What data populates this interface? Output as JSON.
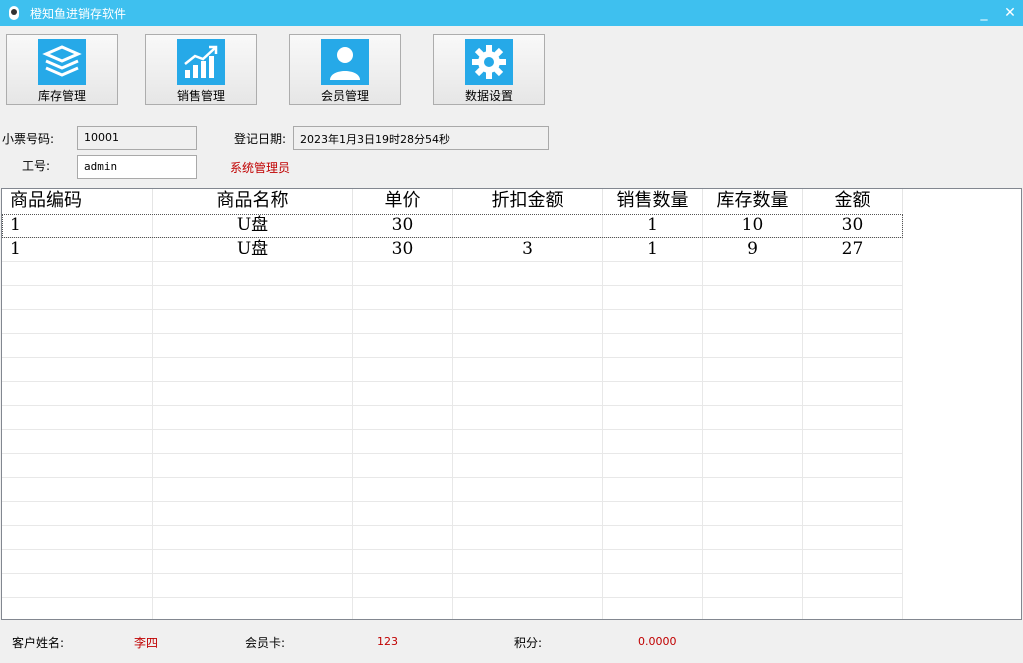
{
  "window": {
    "title": "橙知鱼进销存软件",
    "minimize": "_",
    "close": "✕"
  },
  "toolbar": [
    {
      "label": "库存管理",
      "icon": "layers-icon"
    },
    {
      "label": "销售管理",
      "icon": "bar-chart-icon"
    },
    {
      "label": "会员管理",
      "icon": "user-icon"
    },
    {
      "label": "数据设置",
      "icon": "gear-icon"
    }
  ],
  "form": {
    "receipt_label": "小票号码:",
    "receipt_value": "10001",
    "date_label": "登记日期:",
    "date_value": "2023年1月3日19时28分54秒",
    "staff_label": "工号:",
    "staff_value": "admin",
    "role": "系统管理员"
  },
  "table": {
    "columns": [
      "商品编码",
      "商品名称",
      "单价",
      "折扣金额",
      "销售数量",
      "库存数量",
      "金额"
    ],
    "rows": [
      [
        "1",
        "U盘",
        "30",
        "",
        "1",
        "10",
        "30"
      ],
      [
        "1",
        "U盘",
        "30",
        "3",
        "1",
        "9",
        "27"
      ]
    ]
  },
  "status": {
    "customer_label": "客户姓名:",
    "customer_value": "李四",
    "card_label": "会员卡:",
    "card_value": "123",
    "points_label": "积分:",
    "points_value": "0.0000"
  },
  "colors": {
    "titlebar": "#3ec0ef",
    "icon_bg": "#26a9e8",
    "accent_red": "#c00000"
  }
}
